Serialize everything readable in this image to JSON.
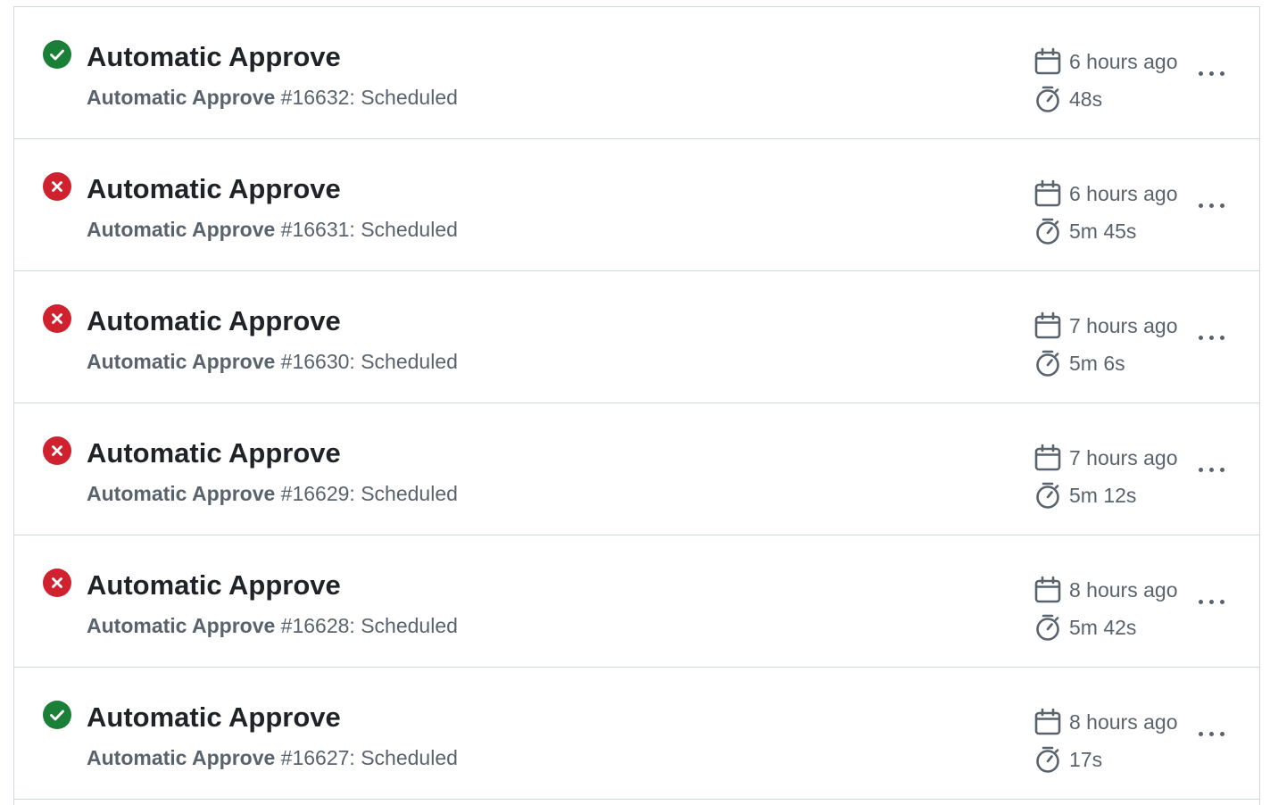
{
  "colors": {
    "success": "#1a7f37",
    "failure": "#cf222e",
    "muted": "#59636e",
    "border": "#d0d7de"
  },
  "runs": [
    {
      "status": "success",
      "title": "Automatic Approve",
      "workflow": "Automatic Approve",
      "detail": "#16632: Scheduled",
      "time": "6 hours ago",
      "duration": "48s"
    },
    {
      "status": "failure",
      "title": "Automatic Approve",
      "workflow": "Automatic Approve",
      "detail": "#16631: Scheduled",
      "time": "6 hours ago",
      "duration": "5m 45s"
    },
    {
      "status": "failure",
      "title": "Automatic Approve",
      "workflow": "Automatic Approve",
      "detail": "#16630: Scheduled",
      "time": "7 hours ago",
      "duration": "5m 6s"
    },
    {
      "status": "failure",
      "title": "Automatic Approve",
      "workflow": "Automatic Approve",
      "detail": "#16629: Scheduled",
      "time": "7 hours ago",
      "duration": "5m 12s"
    },
    {
      "status": "failure",
      "title": "Automatic Approve",
      "workflow": "Automatic Approve",
      "detail": "#16628: Scheduled",
      "time": "8 hours ago",
      "duration": "5m 42s"
    },
    {
      "status": "success",
      "title": "Automatic Approve",
      "workflow": "Automatic Approve",
      "detail": "#16627: Scheduled",
      "time": "8 hours ago",
      "duration": "17s"
    }
  ],
  "icons": {
    "success": "check-circle-icon",
    "failure": "x-circle-icon",
    "time": "calendar-icon",
    "duration": "stopwatch-icon",
    "menu": "kebab-horizontal-icon"
  }
}
